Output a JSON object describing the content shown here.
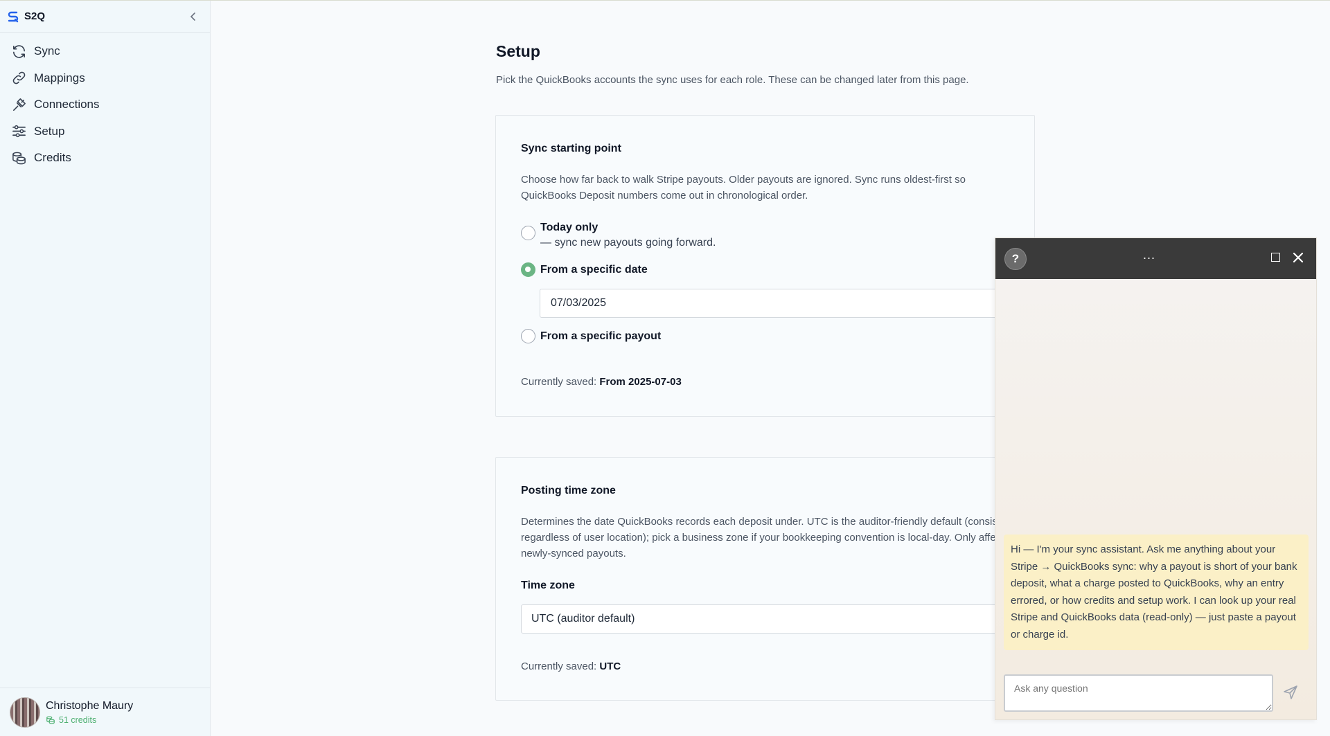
{
  "app": {
    "name": "S2Q"
  },
  "sidebar": {
    "items": [
      {
        "label": "Sync",
        "icon": "sync-icon"
      },
      {
        "label": "Mappings",
        "icon": "link-icon"
      },
      {
        "label": "Connections",
        "icon": "plug-icon"
      },
      {
        "label": "Setup",
        "icon": "sliders-icon"
      },
      {
        "label": "Credits",
        "icon": "coins-icon"
      }
    ],
    "user": {
      "name": "Christophe Maury",
      "credits": "51 credits"
    }
  },
  "page": {
    "title": "Setup",
    "subtitle": "Pick the QuickBooks accounts the sync uses for each role. These can be changed later from this page."
  },
  "sync_start": {
    "title": "Sync starting point",
    "description": "Choose how far back to walk Stripe payouts. Older payouts are ignored. Sync runs oldest-first so QuickBooks Deposit numbers come out in chronological order.",
    "options": [
      {
        "label": "Today only",
        "hint": "— sync new payouts going forward.",
        "checked": false
      },
      {
        "label": "From a specific date",
        "checked": true
      },
      {
        "label": "From a specific payout",
        "checked": false
      }
    ],
    "date_value": "07/03/2025",
    "saved_prefix": "Currently saved:",
    "saved_value": "From 2025-07-03"
  },
  "time_zone": {
    "title": "Posting time zone",
    "description": "Determines the date QuickBooks records each deposit under. UTC is the auditor-friendly default (consistent regardless of user location); pick a business zone if your bookkeeping convention is local-day. Only affects newly-synced payouts.",
    "field_label": "Time zone",
    "selected": "UTC (auditor default)",
    "saved_prefix": "Currently saved:",
    "saved_value": "UTC"
  },
  "chat": {
    "help_glyph": "?",
    "dots": "...",
    "message": "Hi — I'm your sync assistant. Ask me anything about your Stripe → QuickBooks sync: why a payout is short of your bank deposit, what a charge posted to QuickBooks, why an entry errored, or how credits and setup work. I can look up your real Stripe and QuickBooks data (read-only) — just paste a payout or charge id.",
    "input_placeholder": "Ask any question"
  },
  "colors": {
    "accent_green": "#6bb584",
    "chat_header": "#3a3a3a",
    "bubble": "#fbf0c7"
  }
}
